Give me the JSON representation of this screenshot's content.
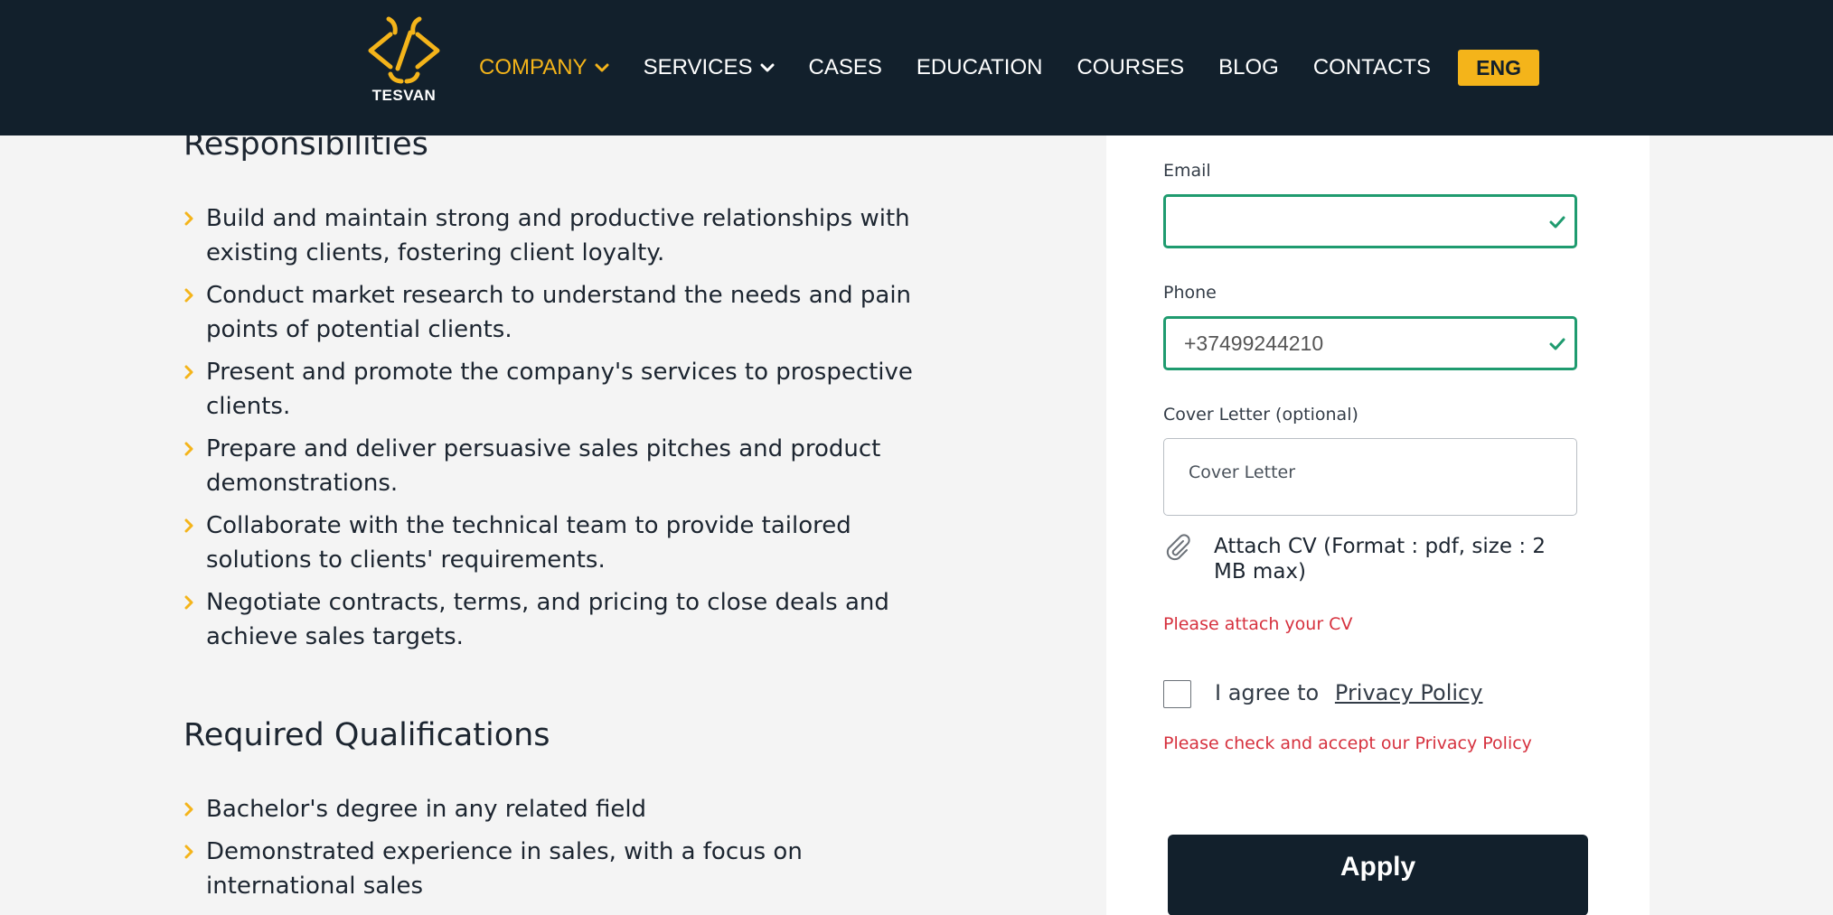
{
  "brand": {
    "logo_text": "TESVAN",
    "accent": "#f4b41a",
    "header_bg": "#12202c"
  },
  "nav": {
    "items": [
      {
        "label": "COMPANY",
        "has_dropdown": true,
        "active": true
      },
      {
        "label": "SERVICES",
        "has_dropdown": true,
        "active": false
      },
      {
        "label": "CASES",
        "has_dropdown": false,
        "active": false
      },
      {
        "label": "EDUCATION",
        "has_dropdown": false,
        "active": false
      },
      {
        "label": "COURSES",
        "has_dropdown": false,
        "active": false
      },
      {
        "label": "BLOG",
        "has_dropdown": false,
        "active": false
      },
      {
        "label": "CONTACTS",
        "has_dropdown": false,
        "active": false
      }
    ],
    "language": "ENG"
  },
  "responsibilities": {
    "title": "Responsibilities",
    "items": [
      "Build and maintain strong and productive relationships with existing clients, fostering client loyalty.",
      "Conduct market research to understand the needs and pain points of potential clients.",
      "Present and promote the company's services to prospective clients.",
      "Prepare and deliver persuasive sales pitches and product demonstrations.",
      "Collaborate with the technical team to provide tailored solutions to clients' requirements.",
      "Negotiate contracts, terms, and pricing to close deals and achieve sales targets."
    ]
  },
  "qualifications": {
    "title": "Required Qualifications",
    "items": [
      "Bachelor's degree in any related field",
      "Demonstrated experience in sales, with a focus on international sales"
    ]
  },
  "form": {
    "email": {
      "label": "Email",
      "value": ""
    },
    "phone": {
      "label": "Phone",
      "value": "+37499244210"
    },
    "cover_letter": {
      "label": "Cover Letter (optional)",
      "placeholder": "Cover Letter"
    },
    "attach_cv": "Attach CV (Format : pdf, size : 2 MB max)",
    "cv_error": "Please attach your CV",
    "agree_text": "I agree to",
    "privacy_link": "Privacy Policy",
    "privacy_error": "Please check and accept our Privacy Policy",
    "apply_label": "Apply",
    "valid_color": "#1f9b6f",
    "error_color": "#d6313e"
  }
}
